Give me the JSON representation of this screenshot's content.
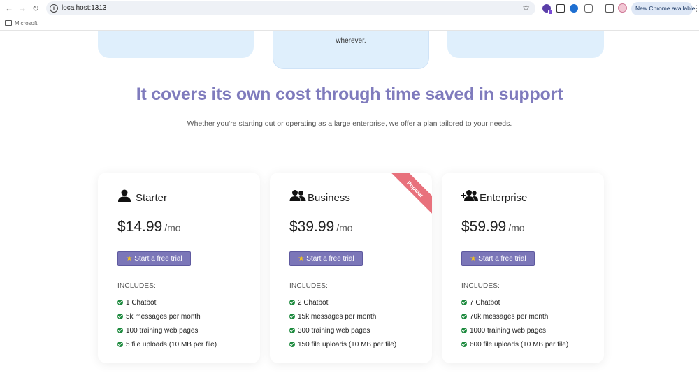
{
  "browser": {
    "url": "localhost:1313",
    "new_chrome_label": "New Chrome available",
    "bookmark_folder": "Microsoft"
  },
  "top_cards": {
    "middle_text": "wherever."
  },
  "section": {
    "headline": "It covers its own cost through time saved in support",
    "subtitle": "Whether you're starting out or operating as a large enterprise, we offer a plan tailored to your needs."
  },
  "plans": [
    {
      "name": "Starter",
      "icon": "user-icon",
      "price": "$14.99",
      "period": "/mo",
      "cta": "Start a free trial",
      "includes_label": "INCLUDES:",
      "features": [
        "1 Chatbot",
        "5k messages per month",
        "100 training web pages",
        "5 file uploads (10 MB per file)"
      ]
    },
    {
      "name": "Business",
      "icon": "users-icon",
      "price": "$39.99",
      "period": "/mo",
      "cta": "Start a free trial",
      "includes_label": "INCLUDES:",
      "ribbon": "Popular",
      "features": [
        "2 Chatbot",
        "15k messages per month",
        "300 training web pages",
        "150 file uploads (10 MB per file)"
      ]
    },
    {
      "name": "Enterprise",
      "icon": "users-plus-icon",
      "price": "$59.99",
      "period": "/mo",
      "cta": "Start a free trial",
      "includes_label": "INCLUDES:",
      "features": [
        "7 Chatbot",
        "70k messages per month",
        "1000 training web pages",
        "600 file uploads (10 MB per file)"
      ]
    }
  ],
  "colors": {
    "accent": "#7b76b8",
    "headline": "#7f7bbd",
    "ribbon": "#e8717c",
    "check": "#1d8a3e",
    "card_bg": "#dfeffc"
  }
}
